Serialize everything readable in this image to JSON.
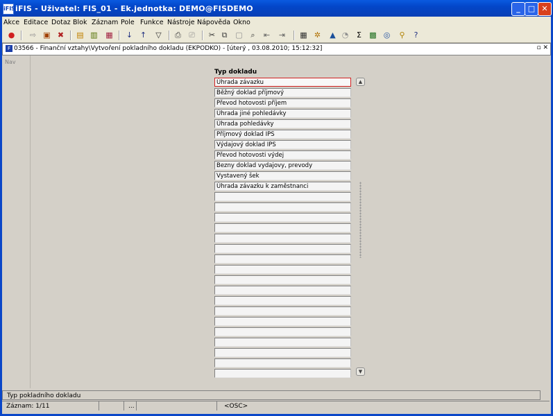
{
  "window": {
    "title": "iFIS - Uživatel: FIS_01 - Ek.jednotka: DEMO@FISDEMO",
    "app_icon": "iFIS",
    "minimize_icon": "_",
    "maximize_icon": "□",
    "close_icon": "✕"
  },
  "menu": [
    "Akce",
    "Editace",
    "Dotaz",
    "Blok",
    "Záznam",
    "Pole",
    "Funkce",
    "Nástroje",
    "Nápověda",
    "Okno"
  ],
  "toolbar_icons": [
    {
      "name": "exit-icon",
      "glyph": "●",
      "color": "#d02020"
    },
    {
      "name": "save-icon",
      "glyph": "⇨",
      "color": "#909090"
    },
    {
      "name": "print-icon",
      "glyph": "▣",
      "color": "#a04000"
    },
    {
      "name": "delete-icon",
      "glyph": "✖",
      "color": "#b02020"
    },
    {
      "name": "insert-record-icon",
      "glyph": "▤",
      "color": "#c08000"
    },
    {
      "name": "query-enter-icon",
      "glyph": "▥",
      "color": "#507000"
    },
    {
      "name": "query-cancel-icon",
      "glyph": "▦",
      "color": "#a02040"
    },
    {
      "name": "sort-asc-icon",
      "glyph": "↓",
      "color": "#203080"
    },
    {
      "name": "sort-desc-icon",
      "glyph": "↑",
      "color": "#203080"
    },
    {
      "name": "filter-icon",
      "glyph": "▽",
      "color": "#303030"
    },
    {
      "name": "printer-icon",
      "glyph": "⎙",
      "color": "#404040"
    },
    {
      "name": "preview-icon",
      "glyph": "⎚",
      "color": "#909090"
    },
    {
      "name": "cut-icon",
      "glyph": "✂",
      "color": "#303030"
    },
    {
      "name": "copy-icon",
      "glyph": "⧉",
      "color": "#404040"
    },
    {
      "name": "paste-icon",
      "glyph": "▢",
      "color": "#909090"
    },
    {
      "name": "find-icon",
      "glyph": "⌕",
      "color": "#303030"
    },
    {
      "name": "prev-record-icon",
      "glyph": "⇤",
      "color": "#606060"
    },
    {
      "name": "next-record-icon",
      "glyph": "⇥",
      "color": "#606060"
    },
    {
      "name": "calendar-icon",
      "glyph": "▦",
      "color": "#303030"
    },
    {
      "name": "settings-icon",
      "glyph": "✲",
      "color": "#b07000"
    },
    {
      "name": "warning-icon",
      "glyph": "▲",
      "color": "#1a4f9a"
    },
    {
      "name": "clock-icon",
      "glyph": "◔",
      "color": "#909090"
    },
    {
      "name": "sum-icon",
      "glyph": "Σ",
      "color": "#000000"
    },
    {
      "name": "excel-icon",
      "glyph": "▩",
      "color": "#207020"
    },
    {
      "name": "browser-icon",
      "glyph": "◎",
      "color": "#2050a0"
    },
    {
      "name": "user-help-icon",
      "glyph": "⚲",
      "color": "#b08000"
    },
    {
      "name": "help-icon",
      "glyph": "?",
      "color": "#203080"
    }
  ],
  "inner_window": {
    "title": "03566 - Finanční vztahy\\Vytvoření pokladního dokladu (EKPODKO) - [úterý , 03.08.2010; 15:12:32]",
    "icon": "F",
    "controls": "▫ ✕"
  },
  "nav": {
    "label": "Nav"
  },
  "list": {
    "header": "Typ dokladu",
    "items": [
      "Úhrada závazku",
      "Běžný doklad příjmový",
      "Převod hotovosti příjem",
      "Úhrada jiné pohledávky",
      "Úhrada pohledávky",
      "Příjmový doklad IPS",
      "Výdajový doklad IPS",
      "Převod hotovosti výdej",
      "Bezny doklad vydajovy, prevody",
      "Vystavený šek",
      "Úhrada závazku k zaměstnanci",
      "",
      "",
      "",
      "",
      "",
      "",
      "",
      "",
      "",
      "",
      "",
      "",
      "",
      "",
      "",
      "",
      "",
      ""
    ],
    "selected_index": 0
  },
  "scrollbar": {
    "up_icon": "▲",
    "down_icon": "▼"
  },
  "status": {
    "hint": "Typ pokladního dokladu",
    "record": "Záznam: 1/11",
    "field2": "",
    "field3": "...",
    "field4": "",
    "mode": "<OSC>"
  }
}
